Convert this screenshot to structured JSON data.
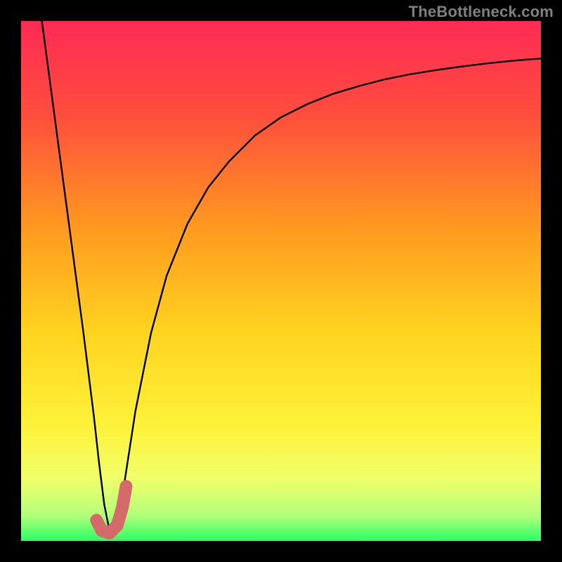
{
  "watermark": "TheBottleneck.com",
  "colors": {
    "frame": "#000000",
    "curve": "#000000",
    "marker": "#d46a6a",
    "gradient_stops": [
      {
        "offset": 0.0,
        "color": "#ff2a55"
      },
      {
        "offset": 0.18,
        "color": "#ff4d3d"
      },
      {
        "offset": 0.4,
        "color": "#ff9a1f"
      },
      {
        "offset": 0.6,
        "color": "#ffd41f"
      },
      {
        "offset": 0.78,
        "color": "#fff23a"
      },
      {
        "offset": 0.88,
        "color": "#f0ff6a"
      },
      {
        "offset": 0.95,
        "color": "#b4ff7a"
      },
      {
        "offset": 1.0,
        "color": "#2bff66"
      }
    ]
  },
  "chart_data": {
    "type": "line",
    "title": "",
    "xlabel": "",
    "ylabel": "",
    "xlim": [
      0,
      100
    ],
    "ylim": [
      0,
      100
    ],
    "note": "Bottleneck-percentage style curve. x = relative component scale, y = bottleneck %. Minimum near x≈17 marks the balanced point.",
    "series": [
      {
        "name": "bottleneck_curve",
        "x": [
          4,
          6,
          8,
          10,
          12,
          14,
          15,
          16,
          17,
          18,
          19,
          20,
          22,
          25,
          28,
          32,
          36,
          40,
          45,
          50,
          55,
          60,
          65,
          70,
          75,
          80,
          85,
          90,
          95,
          100
        ],
        "y": [
          100,
          85,
          70,
          55,
          40,
          24,
          15,
          7,
          2,
          2,
          6,
          12,
          25,
          40,
          51,
          61,
          68,
          73,
          78,
          81.5,
          84,
          86,
          87.5,
          88.8,
          89.8,
          90.6,
          91.3,
          91.9,
          92.4,
          92.8
        ]
      }
    ],
    "marker": {
      "name": "optimal_j_marker",
      "description": "Thick J-shaped tick at curve minimum",
      "points_xy": [
        [
          14.5,
          4.0
        ],
        [
          15.5,
          2.0
        ],
        [
          17.0,
          1.5
        ],
        [
          18.5,
          3.0
        ],
        [
          19.5,
          6.5
        ],
        [
          20.2,
          10.5
        ]
      ]
    }
  }
}
